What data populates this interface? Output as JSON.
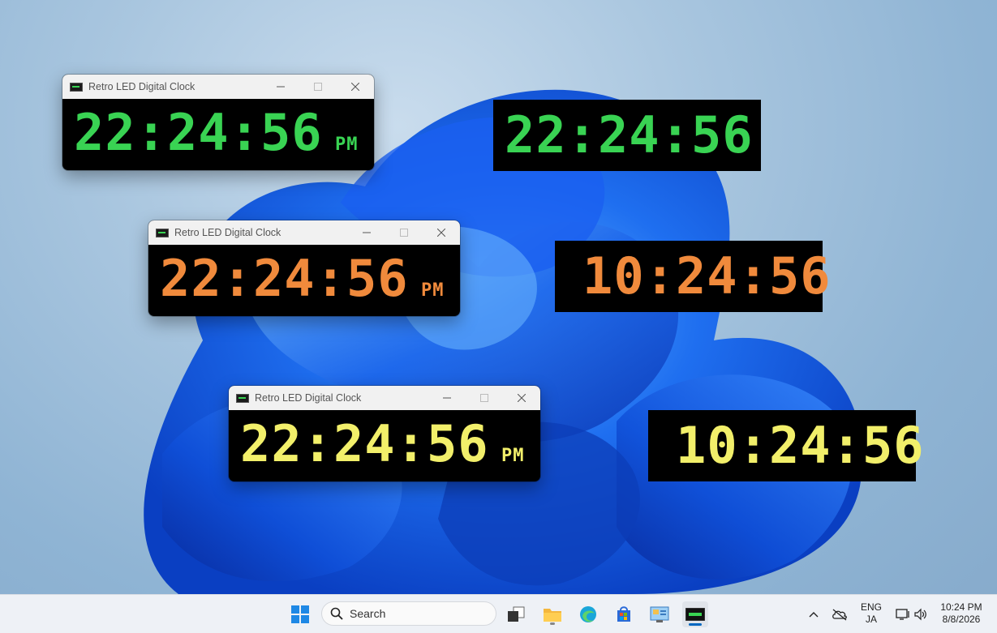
{
  "desktop": {
    "wallpaper": "windows-11-bloom",
    "colors": {
      "green": "#39d353",
      "orange": "#f08a3c",
      "yellow": "#f2ef6a"
    }
  },
  "clock_windows": [
    {
      "title": "Retro LED Digital Clock",
      "time": "22:24:56",
      "ampm": "PM",
      "color": "green"
    },
    {
      "title": "Retro LED Digital Clock",
      "time": "22:24:56",
      "ampm": "PM",
      "color": "orange"
    },
    {
      "title": "Retro LED Digital Clock",
      "time": "22:24:56",
      "ampm": "PM",
      "color": "yellow"
    }
  ],
  "borderless_clocks": [
    {
      "time": "22:24:56",
      "color": "green"
    },
    {
      "time": "10:24:56",
      "color": "orange"
    },
    {
      "time": "10:24:56",
      "color": "yellow"
    }
  ],
  "taskbar": {
    "search_placeholder": "Search",
    "pinned": [
      "start-icon",
      "task-view-icon",
      "file-explorer-icon",
      "edge-icon",
      "store-icon",
      "control-panel-icon",
      "led-clock-app-icon"
    ],
    "tray": {
      "lang_top": "ENG",
      "lang_bottom": "JA",
      "time": "10:24 PM",
      "date": "8/8/2026"
    }
  }
}
